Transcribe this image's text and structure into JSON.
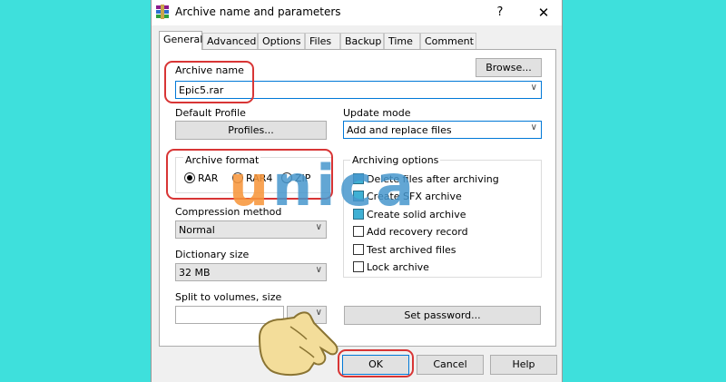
{
  "title": "Archive name and parameters",
  "titlebar": {
    "help": "?",
    "close": "✕"
  },
  "tabs": [
    "General",
    "Advanced",
    "Options",
    "Files",
    "Backup",
    "Time",
    "Comment"
  ],
  "archive_name": {
    "label": "Archive name",
    "value": "Epic5.rar",
    "browse": "Browse..."
  },
  "default_profile": {
    "label": "Default Profile",
    "button": "Profiles..."
  },
  "update_mode": {
    "label": "Update mode",
    "value": "Add and replace files"
  },
  "archive_format": {
    "label": "Archive format",
    "options": [
      {
        "label": "RAR",
        "selected": true
      },
      {
        "label": "RAR4",
        "selected": false
      },
      {
        "label": "ZIP",
        "selected": false
      }
    ]
  },
  "compression": {
    "label": "Compression method",
    "value": "Normal"
  },
  "dictionary": {
    "label": "Dictionary size",
    "value": "32 MB"
  },
  "split": {
    "label": "Split to volumes, size",
    "value": ""
  },
  "archiving_options": {
    "label": "Archiving options",
    "items": [
      {
        "label": "Delete files after archiving",
        "checked": false
      },
      {
        "label": "Create SFX archive",
        "checked": false
      },
      {
        "label": "Create solid archive",
        "checked": false
      },
      {
        "label": "Add recovery record",
        "checked": false
      },
      {
        "label": "Test archived files",
        "checked": false
      },
      {
        "label": "Lock archive",
        "checked": false
      }
    ]
  },
  "set_password": "Set password...",
  "buttons": {
    "ok": "OK",
    "cancel": "Cancel",
    "help": "Help"
  },
  "watermark": {
    "part1": "u",
    "part2": "nica"
  },
  "colors": {
    "background": "#3ee0dc",
    "annotation": "#d83535",
    "focus": "#0078d7"
  }
}
